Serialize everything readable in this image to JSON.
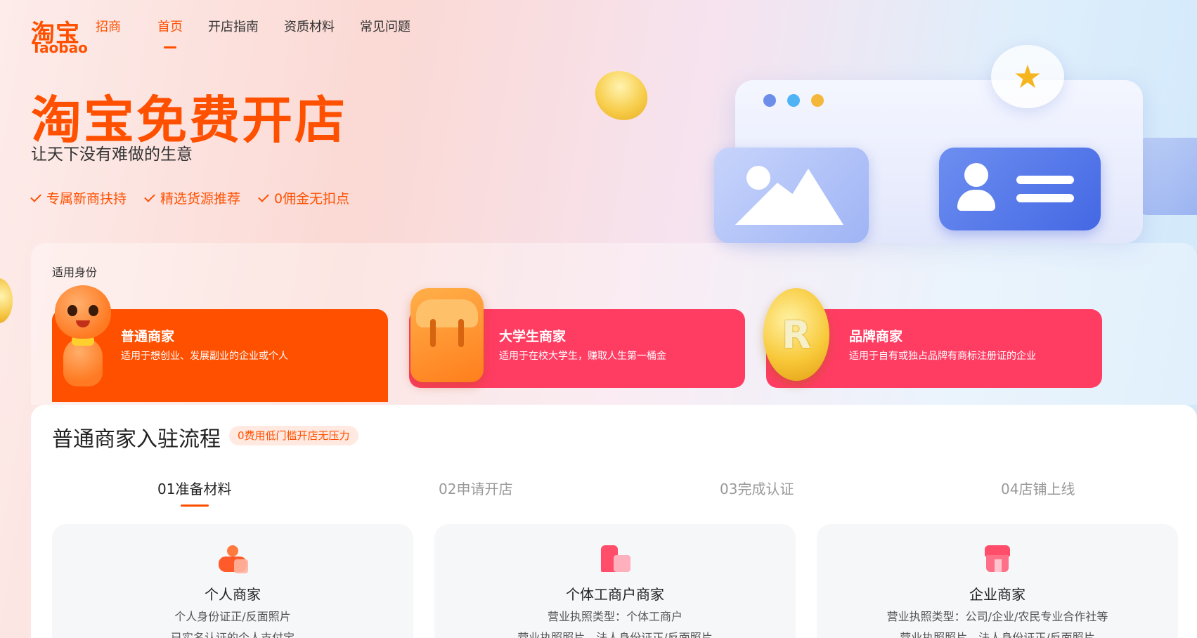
{
  "logo": {
    "cn": "淘宝",
    "en": "Taobao",
    "sub": "招商"
  },
  "nav": {
    "items": [
      {
        "label": "首页",
        "active": true
      },
      {
        "label": "开店指南",
        "active": false
      },
      {
        "label": "资质材料",
        "active": false
      },
      {
        "label": "常见问题",
        "active": false
      }
    ]
  },
  "hero": {
    "title": "淘宝免费开店",
    "subtitle": "让天下没有难做的生意",
    "features": [
      "专属新商扶持",
      "精选货源推荐",
      "0佣金无扣点"
    ]
  },
  "identity": {
    "label": "适用身份",
    "cards": [
      {
        "title": "普通商家",
        "desc": "适用于想创业、发展副业的企业或个人",
        "color": "#ff5000"
      },
      {
        "title": "大学生商家",
        "desc": "适用于在校大学生，赚取人生第一桶金",
        "color": "#ff3d63"
      },
      {
        "title": "品牌商家",
        "desc": "适用于自有或独占品牌有商标注册证的企业",
        "color": "#ff3d63"
      }
    ],
    "coin_letter": "R"
  },
  "process": {
    "title": "普通商家入驻流程",
    "badge": "0费用低门槛开店无压力",
    "steps": [
      {
        "label": "01准备材料",
        "active": true
      },
      {
        "label": "02申请开店",
        "active": false
      },
      {
        "label": "03完成认证",
        "active": false
      },
      {
        "label": "04店铺上线",
        "active": false
      }
    ],
    "cards": [
      {
        "name": "个人商家",
        "line1": "个人身份证正/反面照片",
        "line2": "已实名认证的个人支付宝",
        "icon": "person-icon"
      },
      {
        "name": "个体工商户商家",
        "line1": "营业执照类型：个体工商户",
        "line2": "营业执照照片、法人身份证正/反面照片",
        "icon": "shop-icon"
      },
      {
        "name": "企业商家",
        "line1": "营业执照类型：公司/企业/农民专业合作社等",
        "line2": "营业执照照片、法人身份证正/反面照片",
        "icon": "building-icon"
      }
    ]
  },
  "colors": {
    "brand": "#ff5000",
    "accent": "#ff3d63"
  }
}
